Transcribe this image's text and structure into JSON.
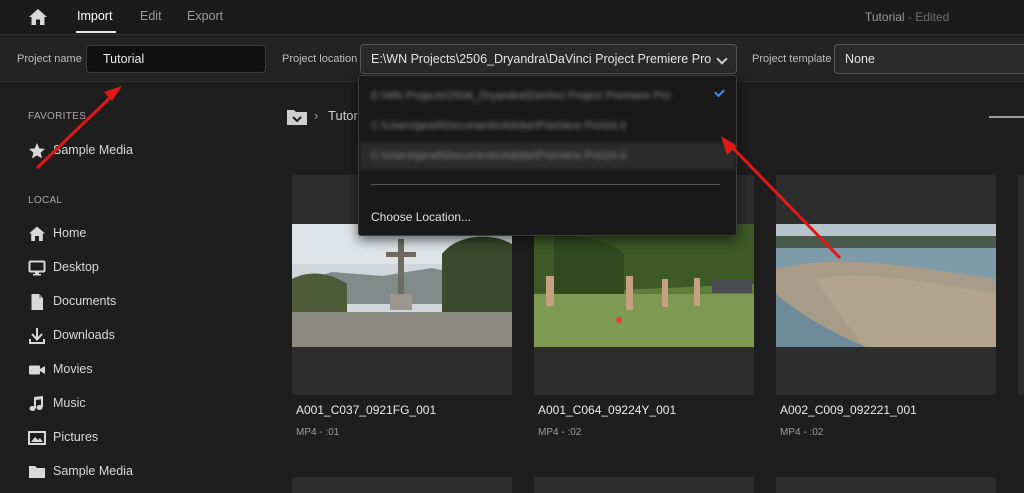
{
  "topbar": {
    "tabs": [
      {
        "label": "Import"
      },
      {
        "label": "Edit"
      },
      {
        "label": "Export"
      }
    ],
    "project_title": "Tutorial",
    "project_status": " - Edited"
  },
  "project_bar": {
    "name_label": "Project name",
    "name_value": "Tutorial",
    "location_label": "Project location",
    "location_value": "E:\\WN Projects\\2506_Dryandra\\DaVinci Project Premiere Pro",
    "template_label": "Project template",
    "template_value": "None"
  },
  "location_dropdown": {
    "options": [
      {
        "label": "E:\\WN Projects\\2506_Dryandra\\DaVinci Project Premiere Pro",
        "selected": true
      },
      {
        "label": "C:\\Users\\janel\\Documents\\Adobe\\Premiere Pro\\24.0",
        "selected": false
      },
      {
        "label": "C:\\Users\\janel\\Documents\\Adobe\\Premiere Pro\\24.0",
        "selected": false
      }
    ],
    "choose_label": "Choose Location..."
  },
  "sidebar": {
    "favorites_heading": "FAVORITES",
    "favorites": [
      {
        "label": "Sample Media",
        "icon": "star-icon"
      }
    ],
    "local_heading": "LOCAL",
    "local": [
      {
        "label": "Home",
        "icon": "home-icon"
      },
      {
        "label": "Desktop",
        "icon": "monitor-icon"
      },
      {
        "label": "Documents",
        "icon": "document-icon"
      },
      {
        "label": "Downloads",
        "icon": "download-icon"
      },
      {
        "label": "Movies",
        "icon": "video-camera-icon"
      },
      {
        "label": "Music",
        "icon": "music-note-icon"
      },
      {
        "label": "Pictures",
        "icon": "image-icon"
      },
      {
        "label": "Sample Media",
        "icon": "folder-icon"
      }
    ]
  },
  "main": {
    "breadcrumb": "Tutor",
    "clips": [
      {
        "name": "A001_C037_0921FG_001",
        "meta": "MP4 - :01"
      },
      {
        "name": "A001_C064_09224Y_001",
        "meta": "MP4 - :02"
      },
      {
        "name": "A002_C009_092221_001",
        "meta": "MP4 - :02"
      }
    ]
  },
  "colors": {
    "background": "#1e1e1e",
    "accent_check": "#3f8ef0",
    "annotation_arrow": "#e01818"
  }
}
